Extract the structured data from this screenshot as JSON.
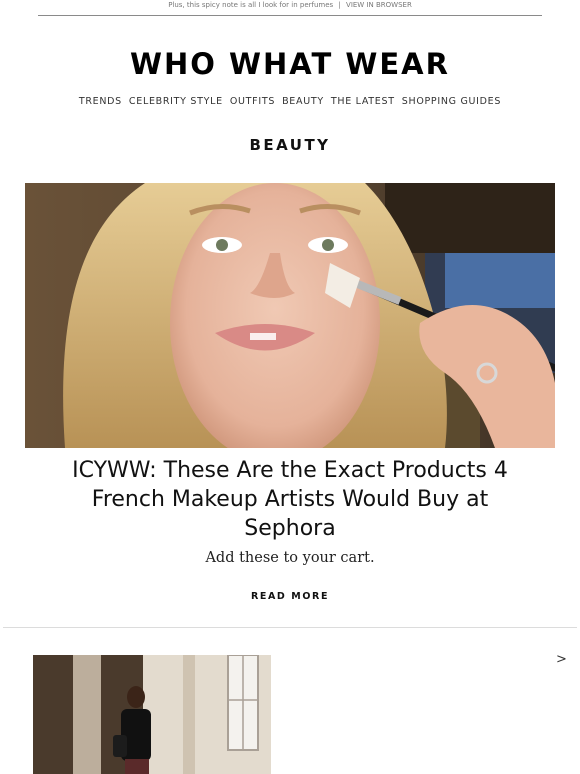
{
  "preheader": {
    "text": "Plus, this spicy note is all I look for in perfumes",
    "separator": "|",
    "link": "VIEW IN BROWSER"
  },
  "brand": {
    "logo": "WHO WHAT WEAR"
  },
  "nav": {
    "items": [
      "TRENDS",
      "CELEBRITY STYLE",
      "OUTFITS",
      "BEAUTY",
      "THE LATEST",
      "SHOPPING GUIDES"
    ]
  },
  "section": {
    "title": "BEAUTY"
  },
  "article": {
    "headline": "ICYWW: These Are the Exact Products 4 French Makeup Artists Would Buy at Sephora",
    "dek": "Add these to your cart.",
    "cta": "READ MORE"
  },
  "carousel": {
    "next_glyph": ">"
  },
  "icons": {
    "next": "chevron-right-icon"
  },
  "colors": {
    "text": "#111111",
    "muted": "#777777",
    "divider": "#dcdcdc"
  }
}
